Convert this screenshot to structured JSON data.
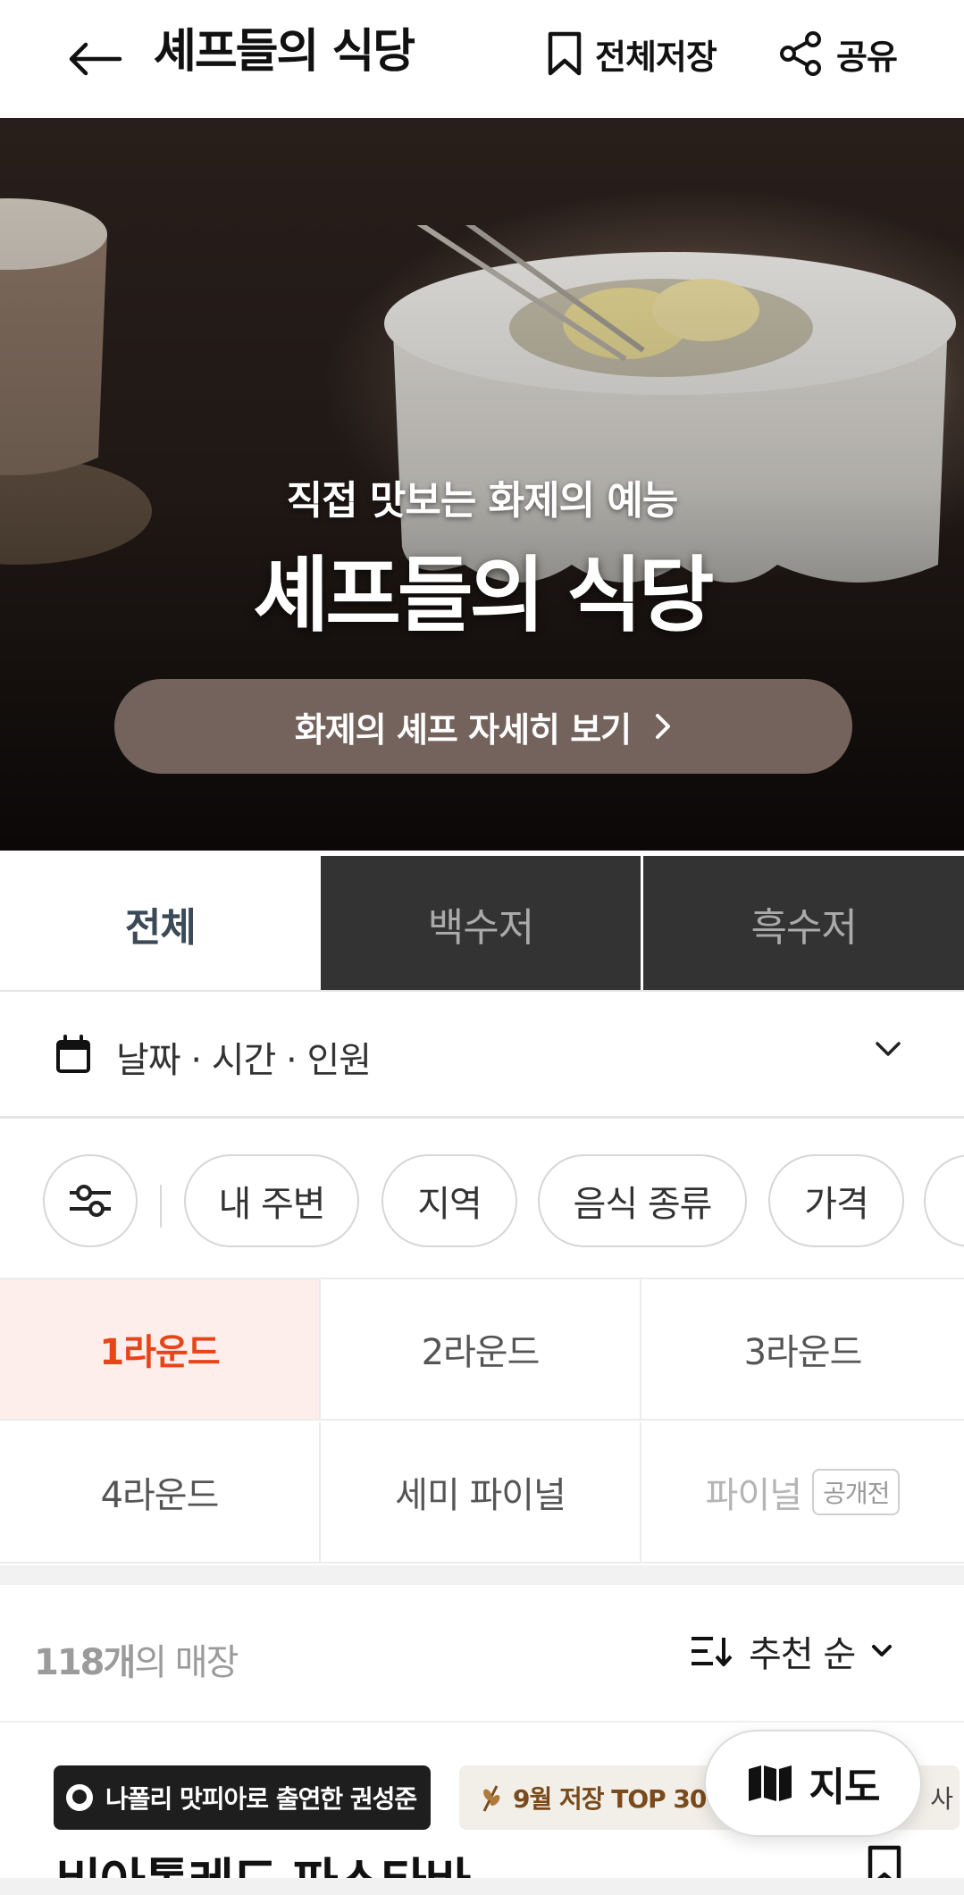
{
  "header": {
    "title": "셰프들의 식당",
    "save_all_label": "전체저장",
    "share_label": "공유"
  },
  "hero": {
    "subtitle": "직접 맛보는 화제의 예능",
    "title": "셰프들의 식당",
    "cta_label": "화제의 셰프 자세히 보기"
  },
  "tabs": [
    {
      "label": "전체",
      "active": true
    },
    {
      "label": "백수저",
      "active": false
    },
    {
      "label": "흑수저",
      "active": false
    }
  ],
  "date_picker": {
    "label": "날짜 · 시간 · 인원"
  },
  "filters": {
    "chips": [
      "내 주변",
      "지역",
      "음식 종류",
      "가격"
    ]
  },
  "rounds": [
    {
      "label": "1라운드",
      "selected": true
    },
    {
      "label": "2라운드",
      "selected": false
    },
    {
      "label": "3라운드",
      "selected": false
    },
    {
      "label": "4라운드",
      "selected": false
    },
    {
      "label": "세미 파이널",
      "selected": false
    },
    {
      "label": "파이널",
      "selected": false,
      "badge": "공개전"
    }
  ],
  "results": {
    "count": "118개",
    "count_suffix": "의 매장",
    "sort_label": "추천 순"
  },
  "store": {
    "tag_primary": "나폴리 맛피아로 출연한 권성준",
    "tag_secondary": "9월 저장 TOP 30",
    "tag_secondary_tail": "사",
    "name": "비아톨레도 파스타바"
  },
  "map_button": {
    "label": "지도"
  },
  "colors": {
    "accent": "#e8441a",
    "selected_bg": "#fdeeeb",
    "dark_tab": "#333333",
    "cta_bg": "#827068"
  },
  "icons": [
    "arrow-left-icon",
    "bookmark-icon",
    "share-icon",
    "chevron-right-icon",
    "calendar-icon",
    "chevron-down-icon",
    "filter-sliders-icon",
    "sort-icon",
    "map-icon",
    "chef-hat-icon",
    "wheat-icon"
  ]
}
